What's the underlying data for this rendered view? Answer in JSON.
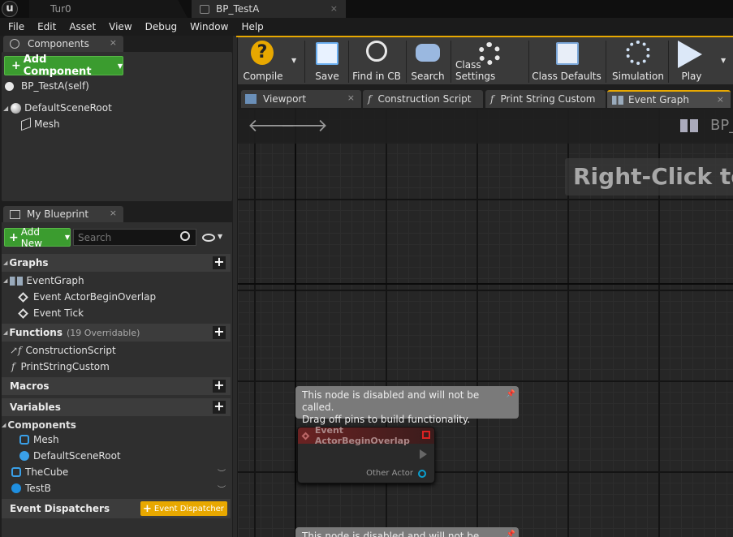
{
  "titlebar": {
    "tabs": [
      {
        "label": "Tur0"
      },
      {
        "label": "BP_TestA",
        "close": "×"
      }
    ]
  },
  "menu": [
    "File",
    "Edit",
    "Asset",
    "View",
    "Debug",
    "Window",
    "Help"
  ],
  "components": {
    "tab": "Components",
    "close": "×",
    "add_label": "Add Component",
    "tree": [
      {
        "label": "BP_TestA(self)"
      },
      {
        "label": "DefaultSceneRoot"
      },
      {
        "label": "Mesh"
      }
    ]
  },
  "my_blueprint": {
    "tab": "My Blueprint",
    "close": "×",
    "add_new": "Add New",
    "search_placeholder": "Search",
    "graphs": {
      "title": "Graphs",
      "items": [
        "EventGraph",
        "Event ActorBeginOverlap",
        "Event Tick"
      ]
    },
    "functions": {
      "title": "Functions",
      "overridable": "(19 Overridable)",
      "items": [
        "ConstructionScript",
        "PrintStringCustom"
      ]
    },
    "macros": {
      "title": "Macros"
    },
    "variables": {
      "title": "Variables",
      "subcat": "Components",
      "items": [
        "Mesh",
        "DefaultSceneRoot",
        "TheCube",
        "TestB"
      ]
    },
    "dispatchers": {
      "title": "Event Dispatchers",
      "button": "Event Dispatcher"
    }
  },
  "toolbar": {
    "buttons": [
      "Compile",
      "Save",
      "Find in CB",
      "Search",
      "Class Settings",
      "Class Defaults",
      "Simulation",
      "Play"
    ]
  },
  "graph_tabs": [
    "Viewport",
    "Construction Script",
    "Print String Custom",
    "Event Graph"
  ],
  "graph": {
    "breadcrumb": "BP_",
    "watermark": "Right-Click to C",
    "comment": {
      "line1": "This node is disabled and will not be called.",
      "line2": "Drag off pins to build functionality."
    },
    "node": {
      "title": "Event ActorBeginOverlap",
      "pin": "Other Actor"
    },
    "comment2": {
      "line1": "This node is disabled and will not be called."
    }
  },
  "colors": {
    "accent_green": "#3b9c2f",
    "dispatcher_yellow": "#e8a800",
    "node_red": "#b02020"
  }
}
